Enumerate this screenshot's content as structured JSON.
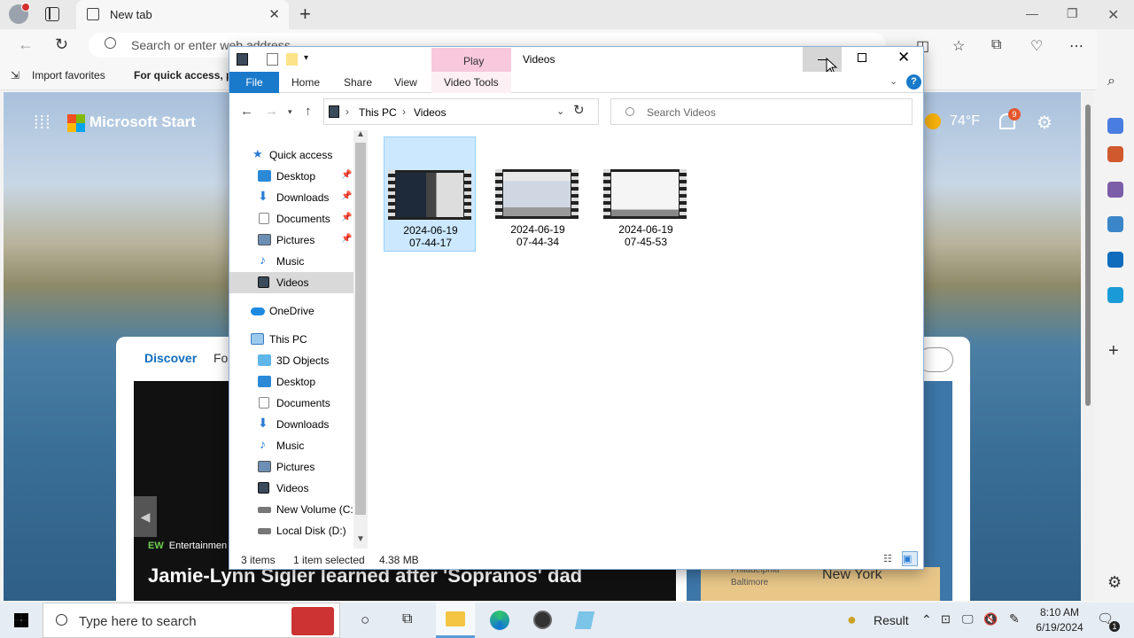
{
  "browser": {
    "tab_title": "New tab",
    "address_placeholder": "Search or enter web address",
    "favorites": [
      "Import favorites",
      "For quick access, pl"
    ]
  },
  "msn": {
    "brand": "Microsoft Start",
    "temperature": "74°F",
    "notification_count": "9",
    "feed_tabs": [
      "Discover",
      "Fo"
    ],
    "hero_source": "Entertainmen",
    "hero_source_badge": "EW",
    "hero_headline": "Jamie-Lynn Sigler learned after 'Sopranos' dad",
    "side_card_city": "New York",
    "side_card_city2": "Philadelphia",
    "side_card_city3": "Baltimore"
  },
  "explorer": {
    "window_title": "Videos",
    "contextual_tab": "Play",
    "ribbon_tabs": [
      "File",
      "Home",
      "Share",
      "View",
      "Video Tools"
    ],
    "breadcrumb": [
      "This PC",
      "Videos"
    ],
    "search_placeholder": "Search Videos",
    "nav_items": [
      {
        "label": "Quick access"
      },
      {
        "label": "Desktop"
      },
      {
        "label": "Downloads"
      },
      {
        "label": "Documents"
      },
      {
        "label": "Pictures"
      },
      {
        "label": "Music"
      },
      {
        "label": "Videos"
      },
      {
        "label": "OneDrive"
      },
      {
        "label": "This PC"
      },
      {
        "label": "3D Objects"
      },
      {
        "label": "Desktop"
      },
      {
        "label": "Documents"
      },
      {
        "label": "Downloads"
      },
      {
        "label": "Music"
      },
      {
        "label": "Pictures"
      },
      {
        "label": "Videos"
      },
      {
        "label": "New Volume (C:"
      },
      {
        "label": "Local Disk (D:)"
      }
    ],
    "files": [
      {
        "line1": "2024-06-19",
        "line2": "07-44-17",
        "selected": true
      },
      {
        "line1": "2024-06-19",
        "line2": "07-44-34",
        "selected": false
      },
      {
        "line1": "2024-06-19",
        "line2": "07-45-53",
        "selected": false
      }
    ],
    "status": {
      "item_count": "3 items",
      "selection": "1 item selected",
      "size": "4.38 MB"
    }
  },
  "taskbar": {
    "search_placeholder": "Type here to search",
    "result_label": "Result",
    "time": "8:10 AM",
    "date": "6/19/2024",
    "notification_count": "1"
  }
}
